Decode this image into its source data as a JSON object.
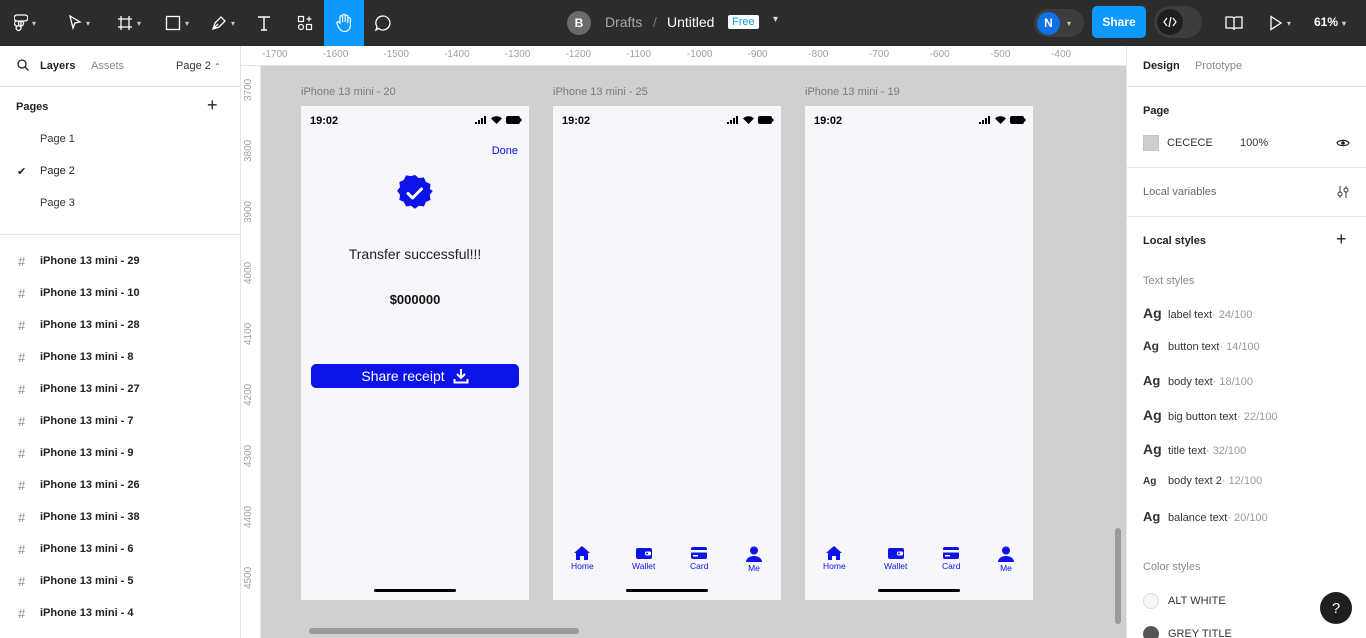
{
  "toolbar": {
    "file_location": "Drafts",
    "separator": "/",
    "file_name": "Untitled",
    "plan_badge": "Free",
    "workspace_avatar": "B",
    "user_avatar": "N",
    "share_label": "Share",
    "zoom": "61%",
    "colors": {
      "bg": "#2c2c2c",
      "active_tool": "#0d99ff",
      "share": "#0d99ff"
    }
  },
  "left_panel": {
    "tabs": {
      "layers": "Layers",
      "assets": "Assets",
      "page_selector": "Page 2"
    },
    "pages_title": "Pages",
    "pages": [
      {
        "label": "Page 1",
        "selected": false
      },
      {
        "label": "Page 2",
        "selected": true
      },
      {
        "label": "Page 3",
        "selected": false
      }
    ],
    "layers": [
      "iPhone 13 mini - 29",
      "iPhone 13 mini - 10",
      "iPhone 13 mini - 28",
      "iPhone 13 mini - 8",
      "iPhone 13 mini - 27",
      "iPhone 13 mini - 7",
      "iPhone 13 mini - 9",
      "iPhone 13 mini - 26",
      "iPhone 13 mini - 38",
      "iPhone 13 mini - 6",
      "iPhone 13 mini - 5",
      "iPhone 13 mini - 4"
    ]
  },
  "canvas": {
    "ruler_x": [
      "-1700",
      "-1600",
      "-1500",
      "-1400",
      "-1300",
      "-1200",
      "-1100",
      "-1000",
      "-900",
      "-800",
      "-700",
      "-600",
      "-500",
      "-400"
    ],
    "ruler_y": [
      "3700",
      "3800",
      "3900",
      "4000",
      "4100",
      "4200",
      "4300",
      "4400",
      "4500"
    ],
    "frames": [
      {
        "label": "iPhone 13 mini - 20",
        "time": "19:02",
        "done": "Done",
        "title": "Transfer successful!!!",
        "amount": "$000000",
        "button": "Share receipt"
      },
      {
        "label": "iPhone 13 mini - 25",
        "time": "19:02"
      },
      {
        "label": "iPhone 13 mini - 19",
        "time": "19:02"
      }
    ],
    "tabs": [
      "Home",
      "Wallet",
      "Card",
      "Me"
    ],
    "accent": "#0b13e8"
  },
  "right_panel": {
    "tabs": {
      "design": "Design",
      "prototype": "Prototype"
    },
    "page_section": "Page",
    "page_color": "CECECE",
    "page_opacity": "100%",
    "local_variables": "Local variables",
    "local_styles": "Local styles",
    "text_styles_title": "Text styles",
    "text_styles": [
      {
        "ag": "Ag",
        "name": "label text",
        "meta": " · 24/100"
      },
      {
        "ag": "Ag",
        "name": "button text",
        "meta": " · 14/100"
      },
      {
        "ag": "Ag",
        "name": "body text",
        "meta": " · 18/100"
      },
      {
        "ag": "Ag",
        "name": "big button text",
        "meta": " · 22/100"
      },
      {
        "ag": "Ag",
        "name": "title text",
        "meta": " · 32/100"
      },
      {
        "ag": "Ag",
        "name": "body text 2",
        "meta": " · 12/100"
      },
      {
        "ag": "Ag",
        "name": "balance text",
        "meta": " · 20/100"
      }
    ],
    "color_styles_title": "Color styles",
    "color_styles": [
      {
        "name": "ALT WHITE",
        "color": "#f6f6fb"
      },
      {
        "name": "GREY TITLE",
        "color": "#555555"
      }
    ],
    "help": "?"
  }
}
